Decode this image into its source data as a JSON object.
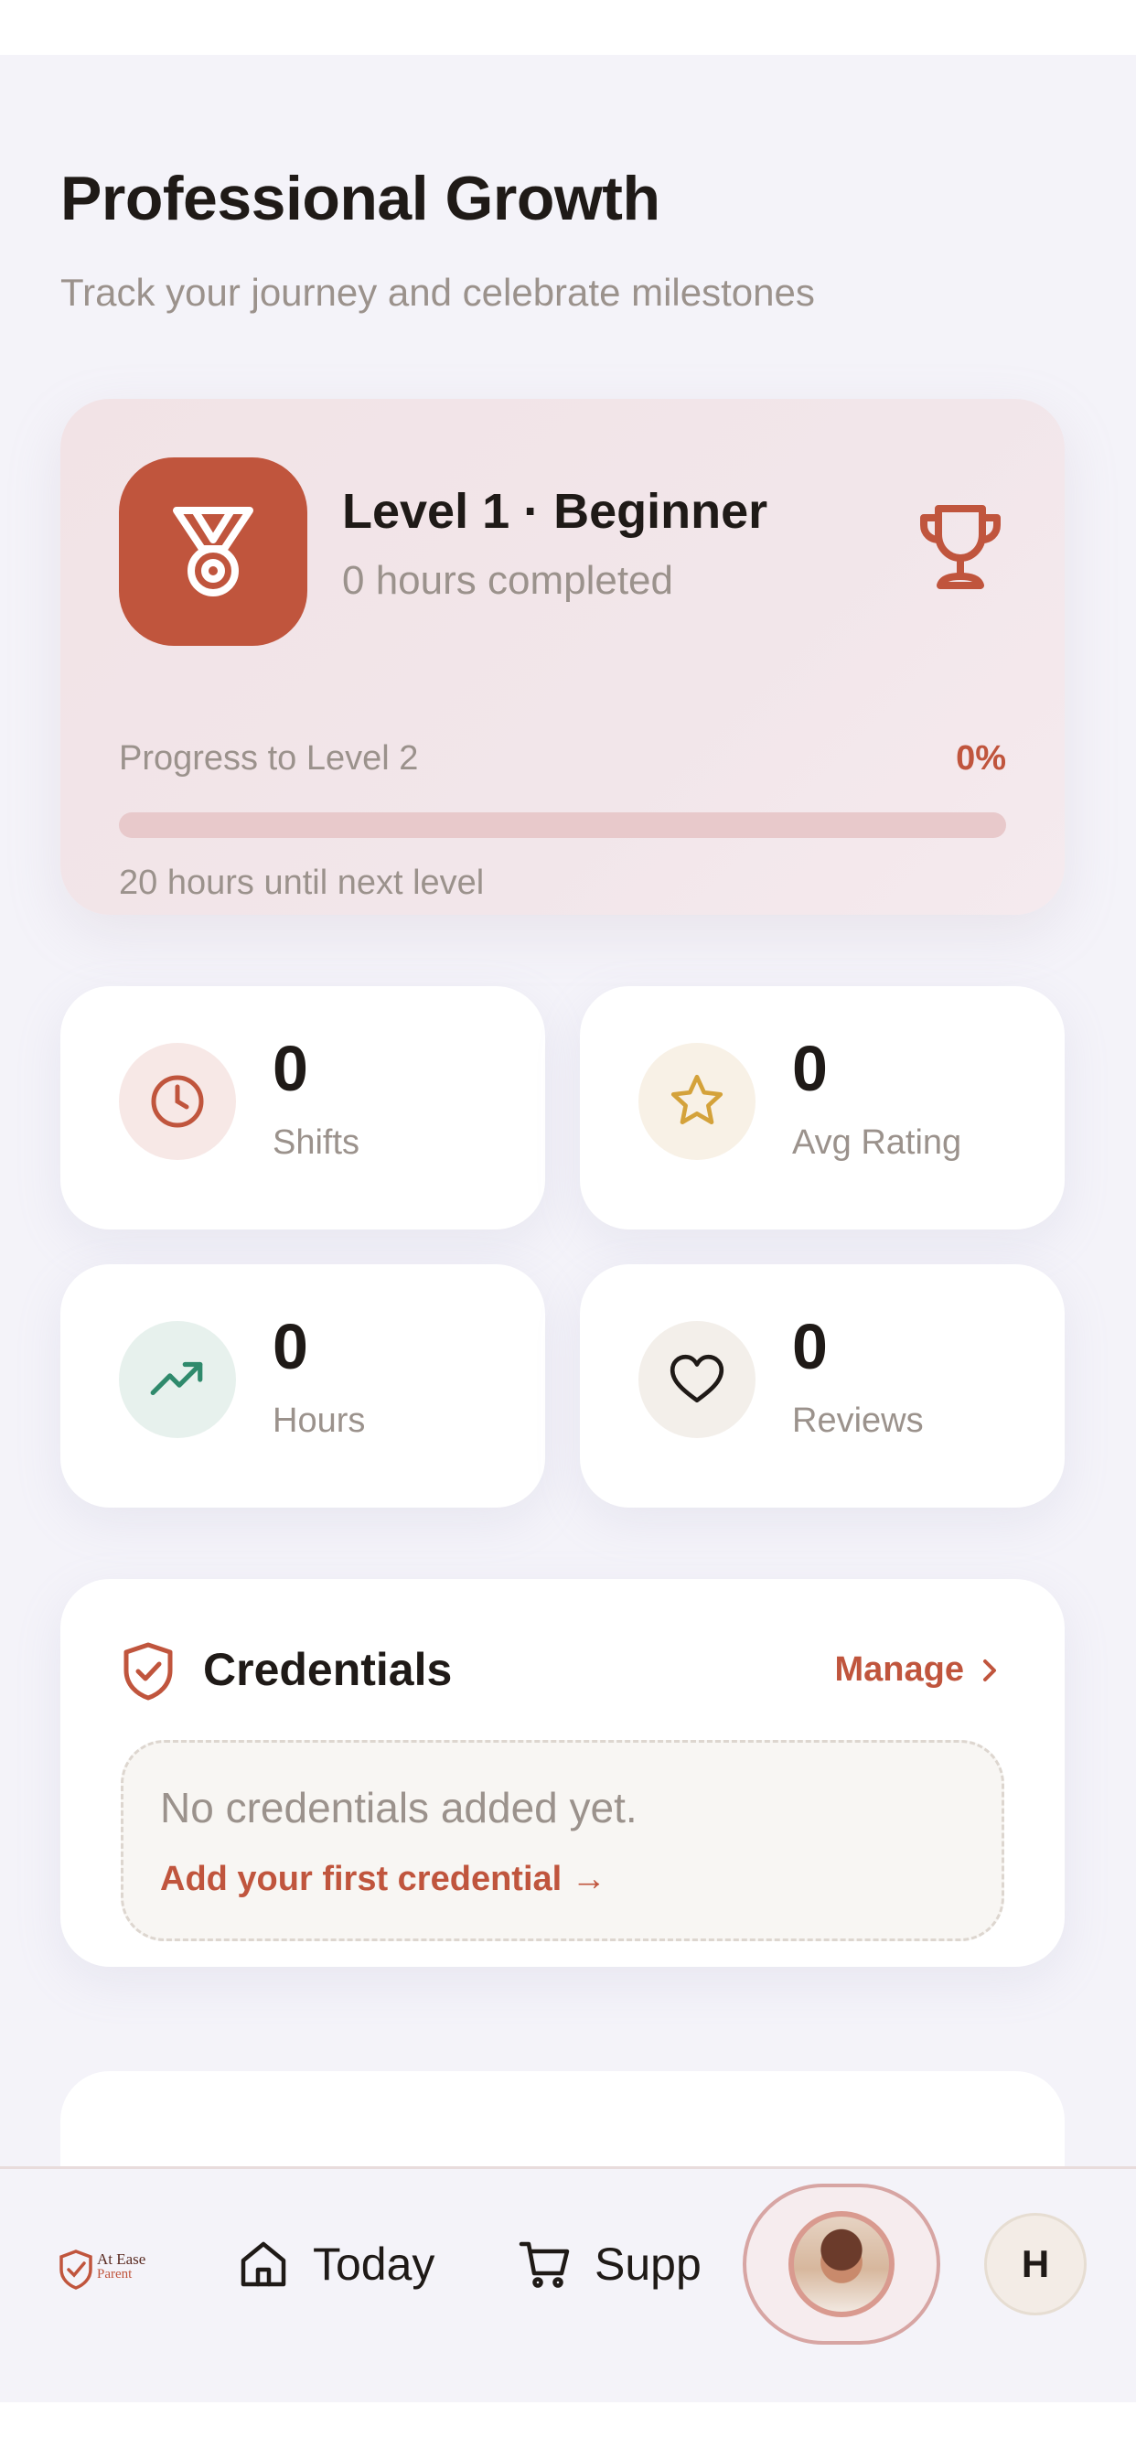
{
  "header": {
    "title": "Professional Growth",
    "subtitle": "Track your journey and celebrate milestones"
  },
  "level": {
    "title": "Level 1 · Beginner",
    "hours": "0 hours completed",
    "progress_label": "Progress to Level 2",
    "progress_percent_text": "0%",
    "progress_fraction": 0,
    "next_level_note": "20 hours until next level",
    "badge_icon": "medal-icon",
    "trophy_icon": "trophy-icon"
  },
  "stats": [
    {
      "value": "0",
      "label": "Shifts",
      "icon": "clock-icon",
      "color": "#c0553d",
      "bg": "#f7e8e6"
    },
    {
      "value": "0",
      "label": "Avg Rating",
      "icon": "star-icon",
      "color": "#d4a23a",
      "bg": "#f8f1e6"
    },
    {
      "value": "0",
      "label": "Hours",
      "icon": "trending-up-icon",
      "color": "#2f8a6c",
      "bg": "#e7f1ed"
    },
    {
      "value": "0",
      "label": "Reviews",
      "icon": "heart-icon",
      "color": "#1f1a17",
      "bg": "#f3efea"
    }
  ],
  "credentials": {
    "title": "Credentials",
    "manage_label": "Manage",
    "empty_text": "No credentials added yet.",
    "add_link": "Add your first credential →"
  },
  "nav": {
    "logo_line1": "At Ease",
    "logo_line2": "Parent",
    "today_label": "Today",
    "supplies_label": "Supp",
    "profile_initial": "H"
  },
  "colors": {
    "accent": "#c0553d",
    "background": "#f4f3f9"
  }
}
